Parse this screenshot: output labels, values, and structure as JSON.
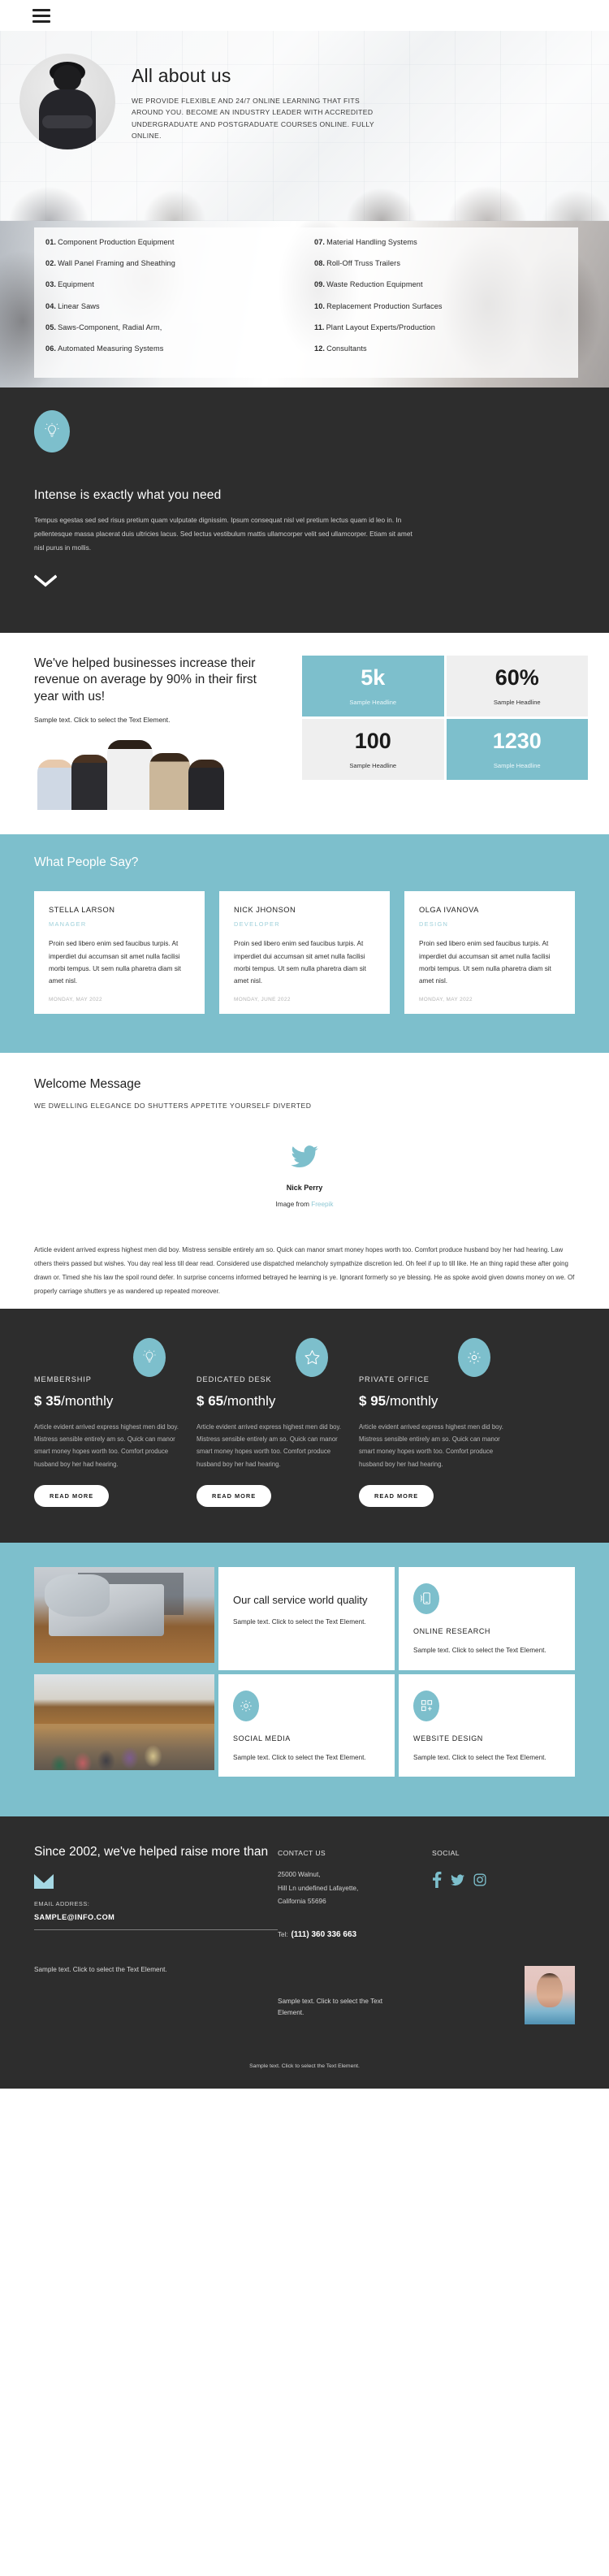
{
  "header": {
    "menu_icon": "hamburger-menu-icon"
  },
  "hero": {
    "title": "All about us",
    "subtitle": "WE PROVIDE FLEXIBLE AND 24/7 ONLINE LEARNING THAT FITS AROUND YOU. BECOME AN INDUSTRY LEADER WITH ACCREDITED UNDERGRADUATE AND POSTGRADUATE COURSES ONLINE. FULLY ONLINE."
  },
  "service_list": {
    "left": [
      {
        "num": "01.",
        "label": "Component Production Equipment"
      },
      {
        "num": "02.",
        "label": "Wall Panel Framing and Sheathing"
      },
      {
        "num": "03.",
        "label": "Equipment"
      },
      {
        "num": "04.",
        "label": "Linear Saws"
      },
      {
        "num": "05.",
        "label": "Saws-Component, Radial Arm,"
      },
      {
        "num": "06.",
        "label": "Automated Measuring Systems"
      }
    ],
    "right": [
      {
        "num": "07.",
        "label": "Material Handling Systems"
      },
      {
        "num": "08.",
        "label": "Roll-Off Truss Trailers"
      },
      {
        "num": "09.",
        "label": "Waste Reduction Equipment"
      },
      {
        "num": "10.",
        "label": "Replacement Production Surfaces"
      },
      {
        "num": "11.",
        "label": "Plant Layout Experts/Production"
      },
      {
        "num": "12.",
        "label": "Consultants"
      }
    ]
  },
  "intense": {
    "icon": "lightbulb-icon",
    "title": "Intense is exactly what you need",
    "body": "Tempus egestas sed sed risus pretium quam vulputate dignissim. Ipsum consequat nisl vel pretium lectus quam id leo in. In pellentesque massa placerat duis ultricies lacus. Sed lectus vestibulum mattis ullamcorper velit sed ullamcorper. Etiam sit amet nisl purus in mollis.",
    "scroll_icon": "chevron-down-icon"
  },
  "stats": {
    "heading": "We've helped businesses increase their revenue on average by 90% in their first year with us!",
    "subtext": "Sample text. Click to select the Text Element.",
    "cells": [
      {
        "value": "5k",
        "label": "Sample Headline",
        "style": "teal"
      },
      {
        "value": "60%",
        "label": "Sample Headline",
        "style": "grey"
      },
      {
        "value": "100",
        "label": "Sample Headline",
        "style": "grey"
      },
      {
        "value": "1230",
        "label": "Sample Headline",
        "style": "teal"
      }
    ]
  },
  "testimonials": {
    "title": "What People Say?",
    "cards": [
      {
        "name": "STELLA LARSON",
        "role": "MANAGER",
        "text": "Proin sed libero enim sed faucibus turpis. At imperdiet dui accumsan sit amet nulla facilisi morbi tempus. Ut sem nulla pharetra diam sit amet nisl.",
        "date": "MONDAY, MAY 2022"
      },
      {
        "name": "NICK JHONSON",
        "role": "DEVELOPER",
        "text": "Proin sed libero enim sed faucibus turpis. At imperdiet dui accumsan sit amet nulla facilisi morbi tempus. Ut sem nulla pharetra diam sit amet nisl.",
        "date": "MONDAY, JUNE 2022"
      },
      {
        "name": "OLGA IVANOVA",
        "role": "DESIGN",
        "text": "Proin sed libero enim sed faucibus turpis. At imperdiet dui accumsan sit amet nulla facilisi morbi tempus. Ut sem nulla pharetra diam sit amet nisl.",
        "date": "MONDAY, MAY 2022"
      }
    ]
  },
  "welcome": {
    "title": "Welcome Message",
    "subtitle": "WE DWELLING ELEGANCE DO SHUTTERS APPETITE YOURSELF DIVERTED",
    "social_icon": "twitter-bird-icon",
    "author": "Nick Perry",
    "credit_prefix": "Image from ",
    "credit_link": "Freepik",
    "article": "Article evident arrived express highest men did boy. Mistress sensible entirely am so. Quick can manor smart money hopes worth too. Comfort produce husband boy her had hearing. Law others theirs passed but wishes. You day real less till dear read. Considered use dispatched melancholy sympathize discretion led. Oh feel if up to till like. He an thing rapid these after going drawn or. Timed she his law the spoil round defer. In surprise concerns informed betrayed he learning is ye. Ignorant formerly so ye blessing. He as spoke avoid given downs money on we. Of properly carriage shutters ye as wandered up repeated moreover."
  },
  "pricing": {
    "plans": [
      {
        "icon": "lightbulb-icon",
        "name": "MEMBERSHIP",
        "currency": "$",
        "amount": "35",
        "period": "/monthly",
        "text": "Article evident arrived express highest men did boy. Mistress sensible entirely am so. Quick can manor smart money hopes worth too. Comfort produce husband boy her had hearing.",
        "button": "READ MORE"
      },
      {
        "icon": "star-icon",
        "name": "DEDICATED DESK",
        "currency": "$",
        "amount": "65",
        "period": "/monthly",
        "text": "Article evident arrived express highest men did boy. Mistress sensible entirely am so. Quick can manor smart money hopes worth too. Comfort produce husband boy her had hearing.",
        "button": "READ MORE"
      },
      {
        "icon": "gear-icon",
        "name": "PRIVATE OFFICE",
        "currency": "$",
        "amount": "95",
        "period": "/monthly",
        "text": "Article evident arrived express highest men did boy. Mistress sensible entirely am so. Quick can manor smart money hopes worth too. Comfort produce husband boy her had hearing.",
        "button": "READ MORE"
      }
    ]
  },
  "services": {
    "feature": {
      "title": "Our call service world quality",
      "text": "Sample text. Click to select the Text Element."
    },
    "cards": [
      {
        "icon": "mobile-phone-icon",
        "name": "ONLINE RESEARCH",
        "text": "Sample text. Click to select the Text Element."
      },
      {
        "icon": "gear-icon",
        "name": "SOCIAL MEDIA",
        "text": "Sample text. Click to select the Text Element."
      },
      {
        "icon": "grid-plus-icon",
        "name": "WEBSITE DESIGN",
        "text": "Sample text. Click to select the Text Element."
      }
    ]
  },
  "footer": {
    "heading": "Since 2002, we've helped raise more than",
    "mail_icon": "envelope-icon",
    "email_label": "EMAIL ADDRESS:",
    "email": "SAMPLE@INFO.COM",
    "left_sample": "Sample text. Click to select the Text Element.",
    "contact_title": "CONTACT US",
    "address": "25000 Walnut,\nHill Ln undefined Lafayette,\nCalifornia 55696",
    "tel_label": "Tel:",
    "tel": "(111) 360 336 663",
    "mid_sample": "Sample text. Click to select the Text Element.",
    "social_title": "SOCIAL",
    "social": [
      {
        "icon": "facebook-icon"
      },
      {
        "icon": "twitter-icon"
      },
      {
        "icon": "instagram-icon"
      }
    ],
    "copyright": "Sample text. Click to select the Text Element."
  },
  "colors": {
    "accent": "#7dbfcc",
    "dark": "#2d2d2d",
    "light_grey": "#efefef",
    "white": "#ffffff"
  }
}
